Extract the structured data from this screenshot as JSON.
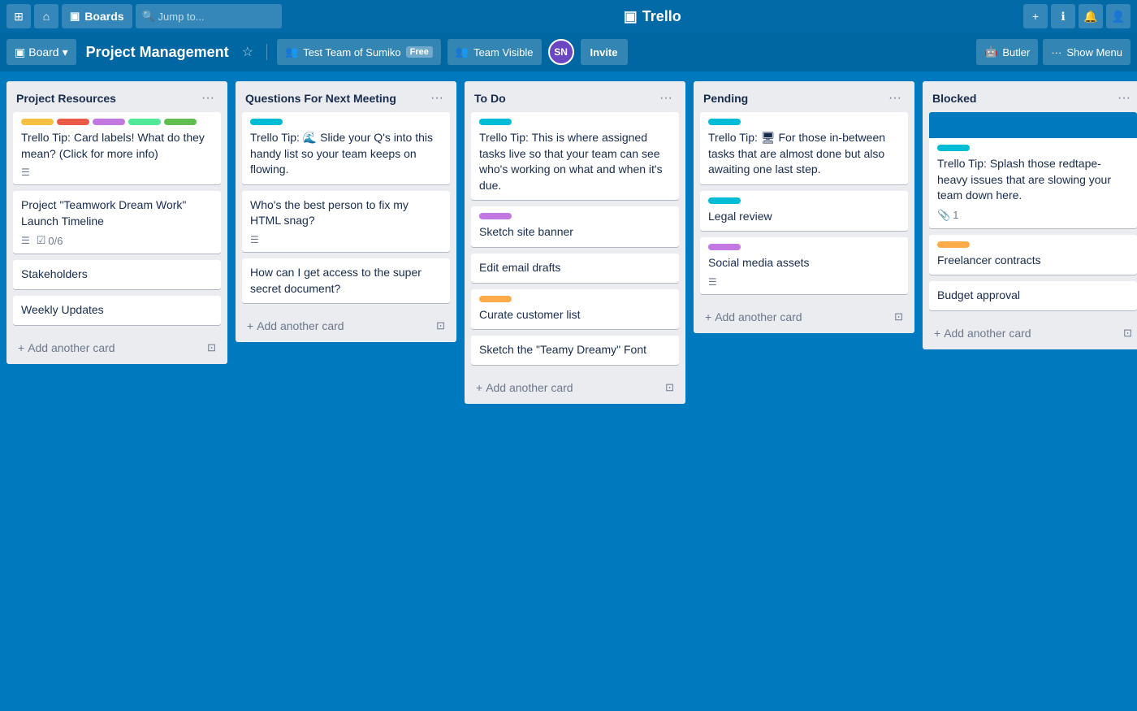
{
  "topNav": {
    "appsIcon": "⊞",
    "homeIcon": "⌂",
    "boardsLabel": "Boards",
    "searchPlaceholder": "Jump to...",
    "logoIcon": "▣",
    "logoText": "Trello",
    "plusIcon": "+",
    "infoIcon": "ℹ",
    "bellIcon": "🔔",
    "userIcon": "👤"
  },
  "boardHeader": {
    "boardIcon": "▣",
    "boardLabel": "Board",
    "boardDropdownIcon": "▾",
    "boardTitle": "Project Management",
    "teamLabel": "Test Team of Sumiko",
    "freeBadge": "Free",
    "visibilityIcon": "👥",
    "visibilityLabel": "Team Visible",
    "avatarInitials": "SN",
    "inviteLabel": "Invite",
    "butlerIcon": "🤖",
    "butlerLabel": "Butler",
    "menuDots": "···",
    "showMenuLabel": "Show Menu"
  },
  "lists": [
    {
      "id": "project-resources",
      "title": "Project Resources",
      "cards": [
        {
          "id": "tip-card-1",
          "labels": [
            "yellow",
            "red",
            "purple",
            "teal2",
            "green"
          ],
          "text": "Trello Tip: Card labels! What do they mean? (Click for more info)",
          "hasDesc": true
        },
        {
          "id": "teamwork-card",
          "text": "Project \"Teamwork Dream Work\" Launch Timeline",
          "hasDesc": true,
          "hasChecklist": true,
          "checklistText": "0/6"
        },
        {
          "id": "stakeholders-card",
          "text": "Stakeholders"
        },
        {
          "id": "weekly-updates-card",
          "text": "Weekly Updates"
        }
      ],
      "addCardLabel": "Add another card"
    },
    {
      "id": "questions-next-meeting",
      "title": "Questions For Next Meeting",
      "cards": [
        {
          "id": "tip-card-2",
          "labels": [
            "teal"
          ],
          "text": "Trello Tip: 🌊 Slide your Q's into this handy list so your team keeps on flowing."
        },
        {
          "id": "html-card",
          "text": "Who's the best person to fix my HTML snag?",
          "hasDesc": true
        },
        {
          "id": "secret-doc-card",
          "text": "How can I get access to the super secret document?"
        }
      ],
      "addCardLabel": "Add another card"
    },
    {
      "id": "to-do",
      "title": "To Do",
      "cards": [
        {
          "id": "tip-card-3",
          "labels": [
            "teal"
          ],
          "text": "Trello Tip: This is where assigned tasks live so that your team can see who's working on what and when it's due."
        },
        {
          "id": "sketch-banner",
          "labels": [
            "purple"
          ],
          "text": "Sketch site banner"
        },
        {
          "id": "edit-email",
          "text": "Edit email drafts"
        },
        {
          "id": "curate-customer",
          "labels": [
            "orange"
          ],
          "text": "Curate customer list"
        },
        {
          "id": "sketch-font",
          "text": "Sketch the \"Teamy Dreamy\" Font"
        }
      ],
      "addCardLabel": "Add another card"
    },
    {
      "id": "pending",
      "title": "Pending",
      "cards": [
        {
          "id": "tip-card-4",
          "labels": [
            "teal"
          ],
          "text": "Trello Tip: 🖥 For those in-between tasks that are almost done but also awaiting one last step."
        },
        {
          "id": "legal-review",
          "labels": [
            "teal"
          ],
          "text": "Legal review"
        },
        {
          "id": "social-media",
          "labels": [
            "purple"
          ],
          "text": "Social media assets",
          "hasDesc": true
        }
      ],
      "addCardLabel": "Add another card"
    },
    {
      "id": "blocked",
      "title": "Blocked",
      "cards": [
        {
          "id": "blocked-blue-header",
          "hasBlueHeader": true,
          "labels": [
            "teal"
          ],
          "text": "Trello Tip: Splash those redtape-heavy issues that are slowing your team down here.",
          "hasAttachment": true,
          "attachmentCount": "1"
        },
        {
          "id": "freelancer-contracts",
          "labels": [
            "orange"
          ],
          "text": "Freelancer contracts"
        },
        {
          "id": "budget-approval",
          "text": "Budget approval"
        }
      ],
      "addCardLabel": "Add another card"
    }
  ]
}
